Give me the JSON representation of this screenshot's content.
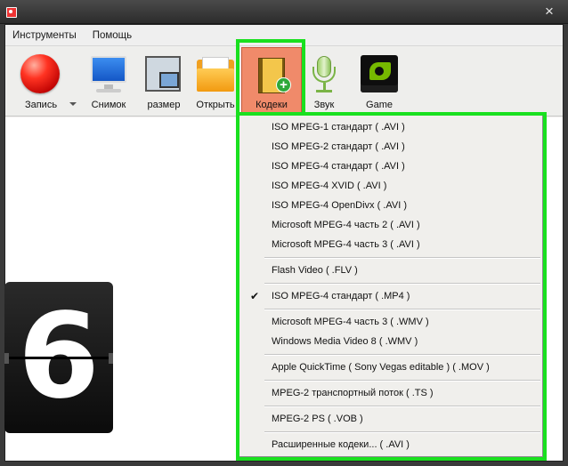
{
  "window": {
    "close_glyph": "×"
  },
  "menu": {
    "items": [
      "Инструменты",
      "Помощь"
    ]
  },
  "toolbar": {
    "items": [
      {
        "id": "record",
        "label": "Запись",
        "icon": "record-icon"
      },
      {
        "id": "snapshot",
        "label": "Снимок",
        "icon": "monitor-icon"
      },
      {
        "id": "resize",
        "label": "размер",
        "icon": "resize-icon"
      },
      {
        "id": "open",
        "label": "Открыть",
        "icon": "folder-icon"
      },
      {
        "id": "codecs",
        "label": "Кодеки",
        "icon": "film-plus-icon",
        "active": true
      },
      {
        "id": "sound",
        "label": "Звук",
        "icon": "microphone-icon"
      },
      {
        "id": "game",
        "label": "Game",
        "icon": "nvidia-icon"
      }
    ]
  },
  "codec_menu": {
    "items": [
      "ISO MPEG-1 стандарт ( .AVI )",
      "ISO MPEG-2 стандарт ( .AVI )",
      "ISO MPEG-4 стандарт ( .AVI )",
      "ISO MPEG-4 XVID ( .AVI )",
      "ISO MPEG-4 OpenDivx ( .AVI )",
      "Microsoft MPEG-4 часть 2 ( .AVI )",
      "Microsoft MPEG-4 часть 3 ( .AVI )",
      "Flash Video ( .FLV )",
      "ISO MPEG-4 стандарт ( .MP4 )",
      "Microsoft MPEG-4 часть 3 ( .WMV )",
      "Windows Media Video 8 ( .WMV )",
      "Apple QuickTime ( Sony Vegas editable ) ( .MOV )",
      "MPEG-2 транспортный поток ( .TS )",
      "MPEG-2 PS ( .VOB )",
      "Расширенные кодеки... ( .AVI )"
    ],
    "checked_index": 8,
    "check_glyph": "✔"
  },
  "counter": {
    "digit": "6"
  },
  "colors": {
    "highlight_green": "#19e01f",
    "active_tool_bg": "#f08a6a"
  }
}
